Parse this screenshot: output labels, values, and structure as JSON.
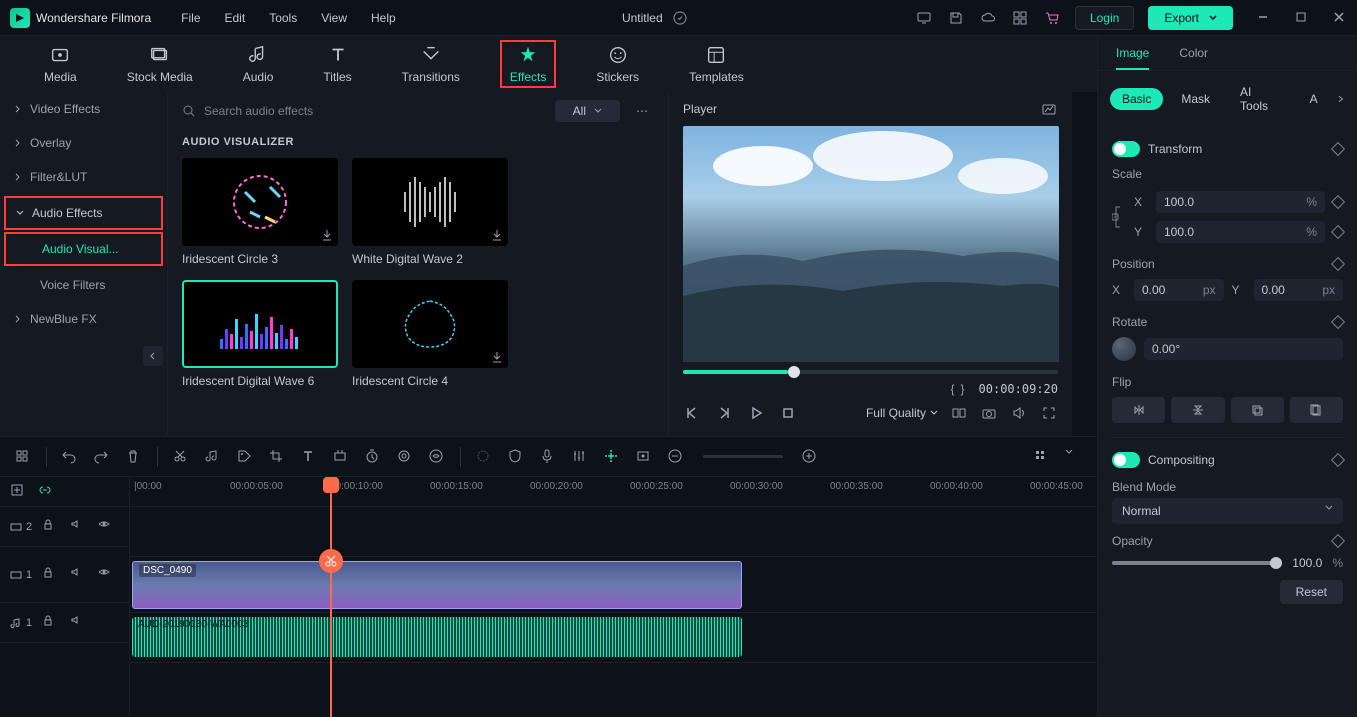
{
  "app": {
    "title": "Wondershare Filmora"
  },
  "menu": {
    "file": "File",
    "edit": "Edit",
    "tools": "Tools",
    "view": "View",
    "help": "Help"
  },
  "document": {
    "title": "Untitled"
  },
  "header": {
    "login": "Login",
    "export": "Export"
  },
  "mainTabs": {
    "media": "Media",
    "stock": "Stock Media",
    "audio": "Audio",
    "titles": "Titles",
    "transitions": "Transitions",
    "effects": "Effects",
    "stickers": "Stickers",
    "templates": "Templates"
  },
  "sidebar": {
    "videoEffects": "Video Effects",
    "overlay": "Overlay",
    "filterLut": "Filter&LUT",
    "audioEffects": "Audio Effects",
    "audioVisualizer": "Audio Visual...",
    "voiceFilters": "Voice Filters",
    "newblue": "NewBlue FX"
  },
  "browser": {
    "searchPlaceholder": "Search audio effects",
    "filter": "All",
    "sectionTitle": "AUDIO VISUALIZER",
    "effects": [
      {
        "label": "Iridescent Circle 3"
      },
      {
        "label": "White  Digital Wave 2"
      },
      {
        "label": "Iridescent Digital Wave 6"
      },
      {
        "label": "Iridescent Circle 4"
      }
    ]
  },
  "player": {
    "title": "Player",
    "timecode": "00:00:09:20",
    "quality": "Full Quality"
  },
  "props": {
    "tabs": {
      "image": "Image",
      "color": "Color"
    },
    "subtabs": {
      "basic": "Basic",
      "mask": "Mask",
      "ai": "AI Tools",
      "a": "A"
    },
    "transform": "Transform",
    "scale": "Scale",
    "scaleX": {
      "label": "X",
      "value": "100.0",
      "unit": "%"
    },
    "scaleY": {
      "label": "Y",
      "value": "100.0",
      "unit": "%"
    },
    "position": "Position",
    "posX": {
      "label": "X",
      "value": "0.00",
      "unit": "px"
    },
    "posY": {
      "label": "Y",
      "value": "0.00",
      "unit": "px"
    },
    "rotate": "Rotate",
    "rotateVal": "0.00°",
    "flip": "Flip",
    "compositing": "Compositing",
    "blendMode": "Blend Mode",
    "blendValue": "Normal",
    "opacity": "Opacity",
    "opacityVal": "100.0",
    "opacityUnit": "%",
    "reset": "Reset"
  },
  "timeline": {
    "ticks": [
      "|00:00",
      "00:00:05:00",
      "00:00:10:00",
      "00:00:15:00",
      "00:00:20:00",
      "00:00:25:00",
      "00:00:30:00",
      "00:00:35:00",
      "00:00:40:00",
      "00:00:45:00"
    ],
    "tracks": {
      "v2": "2",
      "v1": "1",
      "a1": "1"
    },
    "videoClip": "DSC_0490",
    "audioClip": "AUD-20190130-WA0003"
  }
}
